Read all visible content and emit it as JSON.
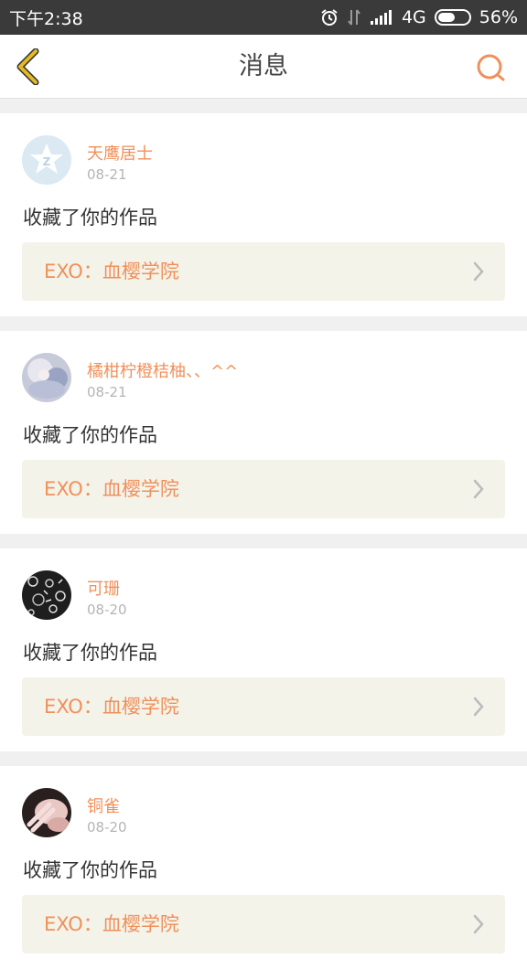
{
  "status_bar": {
    "time": "下午2:38",
    "network": "4G",
    "battery": "56%"
  },
  "header": {
    "title": "消息"
  },
  "colors": {
    "accent": "#f0905a",
    "back_icon": "#e5b923",
    "work_bg": "#f4f3ea"
  },
  "messages": [
    {
      "user": "天鹰居士",
      "date": "08-21",
      "action": "收藏了你的作品",
      "work": "EXO：血樱学院",
      "avatar_icon": "qq-zone-default-avatar"
    },
    {
      "user": "橘柑柠橙桔柚、、^^",
      "date": "08-21",
      "action": "收藏了你的作品",
      "work": "EXO：血樱学院",
      "avatar_icon": "anime-girl-avatar"
    },
    {
      "user": "可珊",
      "date": "08-20",
      "action": "收藏了你的作品",
      "work": "EXO：血樱学院",
      "avatar_icon": "pattern-avatar"
    },
    {
      "user": "铜雀",
      "date": "08-20",
      "action": "收藏了你的作品",
      "work": "EXO：血樱学院",
      "avatar_icon": "hand-photo-avatar"
    }
  ]
}
